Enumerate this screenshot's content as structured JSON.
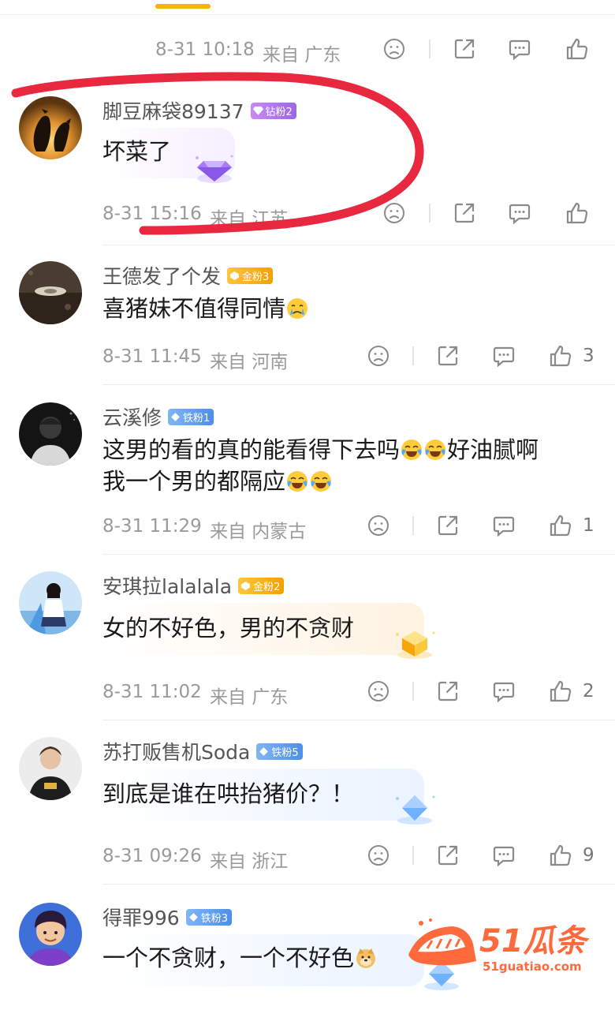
{
  "colors": {
    "accent": "#f5b400",
    "annotation": "#e8283e",
    "meta_text": "#9a9a9a"
  },
  "top_meta": {
    "time": "8-31 10:18",
    "location": "来自 广东"
  },
  "comments": [
    {
      "username": "脚豆麻袋89137",
      "badge": "钻粉2",
      "badge_type": "diamond",
      "text": "坏菜了",
      "time": "8-31 15:16",
      "location": "来自 江苏",
      "likes": ""
    },
    {
      "username": "王德发了个发",
      "badge": "金粉3",
      "badge_type": "gold",
      "text": "喜猪妹不值得同情",
      "time": "8-31 11:45",
      "location": "来自 河南",
      "likes": "3"
    },
    {
      "username": "云溪修",
      "badge": "铁粉1",
      "badge_type": "iron",
      "text_line1": "这男的看的真的能看得下去吗",
      "text_line1_tail": "好油腻啊",
      "text_line2": "我一个男的都隔应",
      "time": "8-31 11:29",
      "location": "来自 内蒙古",
      "likes": "1"
    },
    {
      "username": "安琪拉lalalala",
      "badge": "金粉2",
      "badge_type": "gold",
      "text": "女的不好色，男的不贪财",
      "time": "8-31 11:02",
      "location": "来自 广东",
      "likes": "2"
    },
    {
      "username": "苏打贩售机Soda",
      "badge": "铁粉5",
      "badge_type": "iron",
      "text": "到底是谁在哄抬猪价？！",
      "time": "8-31 09:26",
      "location": "来自 浙江",
      "likes": "9"
    },
    {
      "username": "得罪996",
      "badge": "铁粉3",
      "badge_type": "iron",
      "text": "一个不贪财，一个不好色"
    }
  ],
  "watermark": {
    "brand": "51瓜条",
    "url": "51guatiao.com"
  },
  "icons": [
    "unlike-icon",
    "share-icon",
    "reply-icon",
    "like-icon"
  ]
}
